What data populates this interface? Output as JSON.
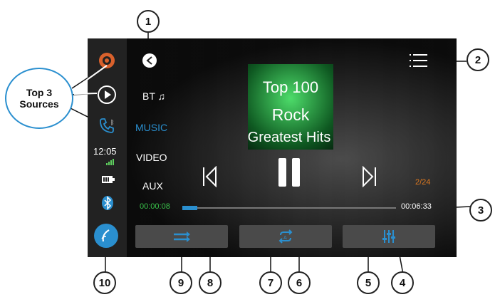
{
  "sidebar": {
    "clock": "12:05"
  },
  "sources": {
    "bt": "BT",
    "music": "MUSIC",
    "video": "VIDEO",
    "aux": "AUX"
  },
  "album": {
    "line1": "Top 100",
    "line2": "Rock",
    "line3": "Greatest Hits"
  },
  "player": {
    "track_counter": "2/24",
    "elapsed": "00:00:08",
    "total": "00:06:33",
    "progress": 0.07
  },
  "annotations": {
    "sources_label_line1": "Top 3",
    "sources_label_line2": "Sources",
    "c1": "1",
    "c2": "2",
    "c3": "3",
    "c4": "4",
    "c5": "5",
    "c6": "6",
    "c7": "7",
    "c8": "8",
    "c9": "9",
    "c10": "10"
  },
  "colors": {
    "accent": "#2a8fcf",
    "elapsed": "#39c24a",
    "counter": "#e07a20"
  }
}
